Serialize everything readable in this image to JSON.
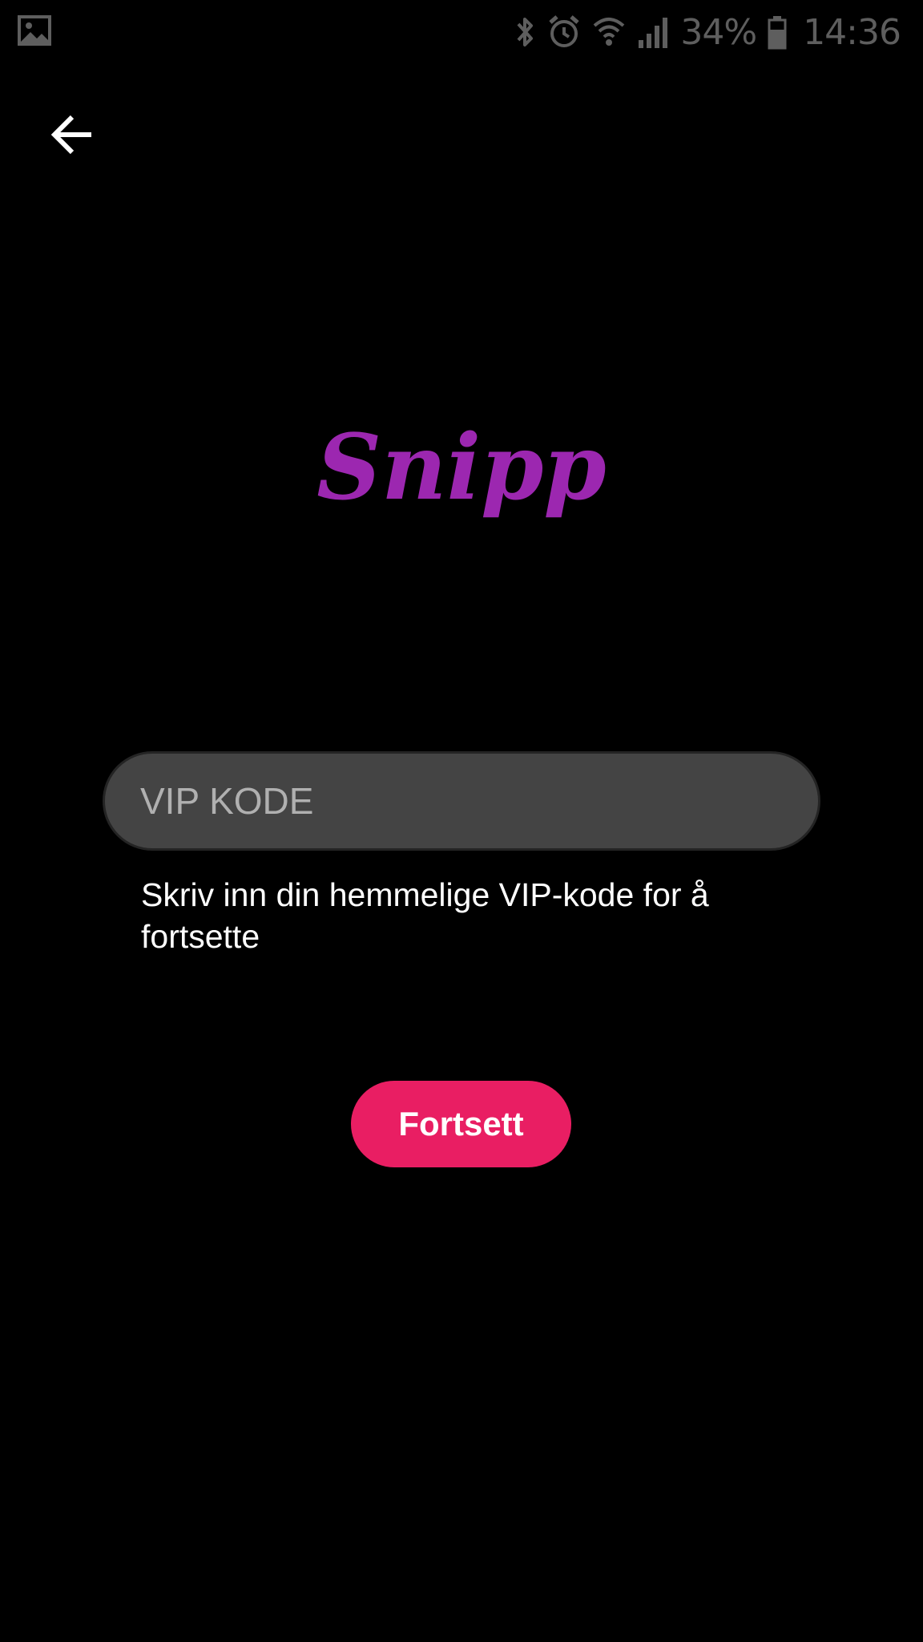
{
  "status_bar": {
    "left_icon": "image-notification-icon",
    "icons": [
      "bluetooth-icon",
      "alarm-icon",
      "wifi-icon",
      "signal-icon",
      "battery-icon"
    ],
    "battery_percent": "34%",
    "time": "14:36"
  },
  "nav": {
    "back_icon": "arrow-left-icon"
  },
  "logo": {
    "text": "Snipp",
    "color": "#9c27b0"
  },
  "vip_input": {
    "placeholder": "VIP KODE",
    "value": ""
  },
  "helper_text": "Skriv inn din hemmelige VIP-kode for å fortsette",
  "continue_button": {
    "label": "Fortsett",
    "color": "#e91e63"
  },
  "colors": {
    "background": "#000000",
    "input_background": "#444444",
    "status_icons": "#5e5e5e"
  }
}
